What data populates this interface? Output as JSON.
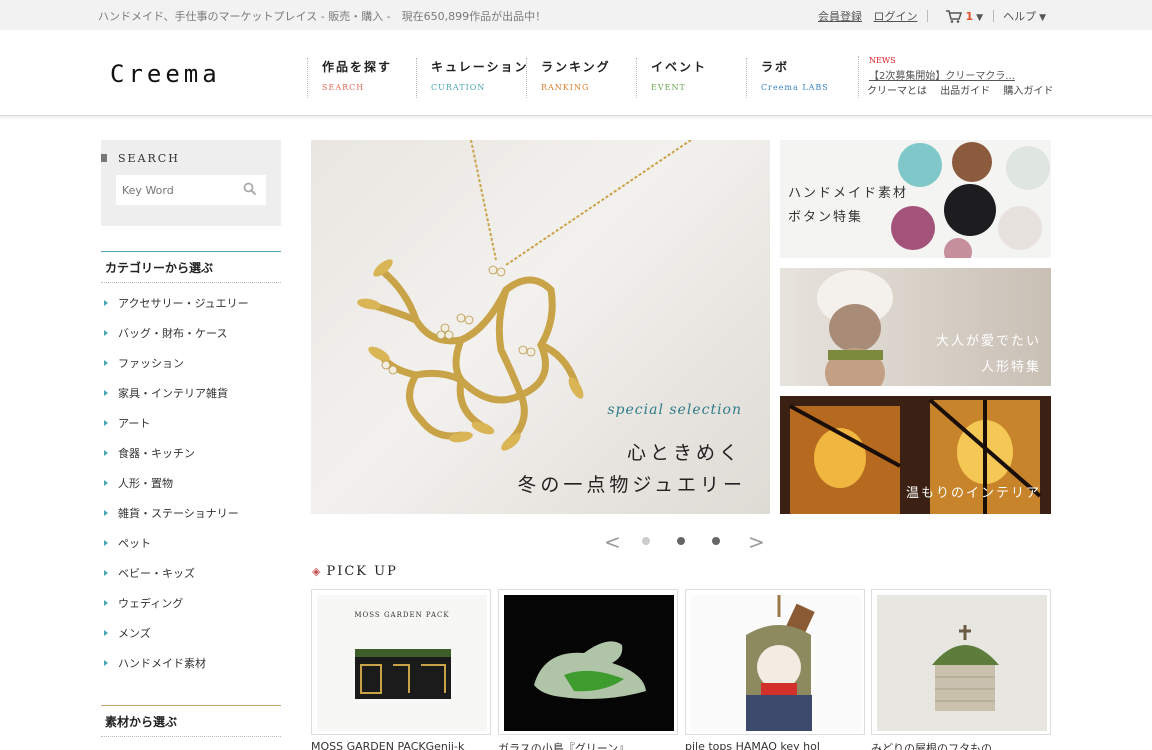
{
  "topbar": {
    "tagline": "ハンドメイド、手仕事のマーケットプレイス - 販売・購入 -　現在650,899作品が出品中！",
    "register": "会員登録",
    "login": "ログイン",
    "cart_count": "1",
    "help": "ヘルプ"
  },
  "header": {
    "logo": "Creema",
    "nav": [
      {
        "jp": "作品を探す",
        "en": "SEARCH",
        "color": "#e26b5b"
      },
      {
        "jp": "キュレーション",
        "en": "CURATION",
        "color": "#4aa6b5"
      },
      {
        "jp": "ランキング",
        "en": "RANKING",
        "color": "#e0802a"
      },
      {
        "jp": "イベント",
        "en": "EVENT",
        "color": "#6aa84f"
      },
      {
        "jp": "ラボ",
        "en": "Creema LABS",
        "color": "#3d85c6"
      }
    ],
    "news_label": "NEWS",
    "news_text": "【2次募集開始】クリーマクラ...",
    "news_links": [
      "クリーマとは",
      "出品ガイド",
      "購入ガイド"
    ]
  },
  "search": {
    "title": "SEARCH",
    "placeholder": "Key Word"
  },
  "sidebar": {
    "category_title": "カテゴリーから選ぶ",
    "categories": [
      "アクセサリー・ジュエリー",
      "バッグ・財布・ケース",
      "ファッション",
      "家具・インテリア雑貨",
      "アート",
      "食器・キッチン",
      "人形・置物",
      "雑貨・ステーショナリー",
      "ペット",
      "ベビー・キッズ",
      "ウェディング",
      "メンズ",
      "ハンドメイド素材"
    ],
    "material_title": "素材から選ぶ"
  },
  "hero": {
    "subtitle": "special selection",
    "line1": "心ときめく",
    "line2": "冬の一点物ジュエリー"
  },
  "banners": [
    {
      "line1": "ハンドメイド素材",
      "line2": "ボタン特集"
    },
    {
      "line1": "大人が愛でたい",
      "line2": "人形特集"
    },
    {
      "line1": "温もりのインテリア"
    }
  ],
  "slider": {
    "prev": "<",
    "next": ">"
  },
  "pickup": {
    "title": "PICK UP",
    "items": [
      {
        "caption": "MOSS GARDEN PACKGenji-k",
        "label": "MOSS GARDEN PACK"
      },
      {
        "caption": "ガラスの小鳥『グリーン』"
      },
      {
        "caption": "pile tops HAMAO key hol"
      },
      {
        "caption": "みどりの屋根のフタもの"
      }
    ]
  }
}
